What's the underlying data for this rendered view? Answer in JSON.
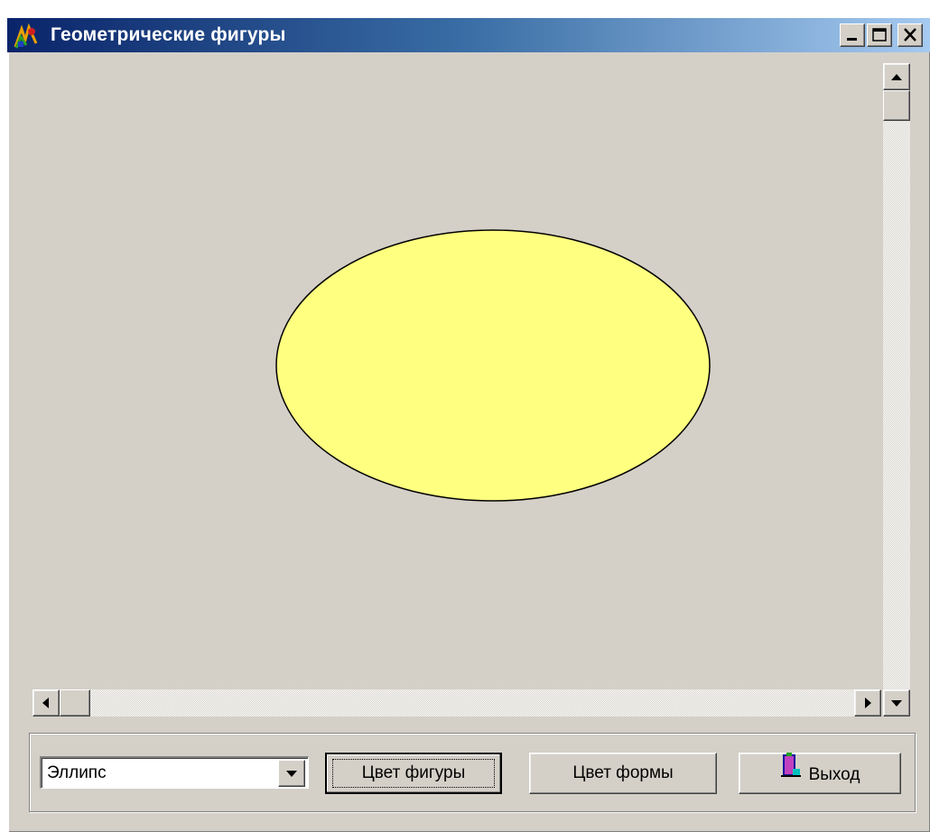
{
  "window": {
    "title": "Геометрические фигуры",
    "background_color": "#d4d0c8",
    "titlebar_colors": [
      "#0a246a",
      "#a6caf0"
    ],
    "icons": {
      "app": "app-figures-icon",
      "minimize": "minimize-icon",
      "maximize": "maximize-icon",
      "close": "close-icon"
    }
  },
  "canvas": {
    "shape": "ellipse",
    "fill_color": "#ffff80",
    "stroke_color": "#000000"
  },
  "scrollbars": {
    "vertical": {
      "position": 0
    },
    "horizontal": {
      "position": 0
    }
  },
  "controls": {
    "shape_select": {
      "value": "Эллипс",
      "icon": "chevron-down-icon"
    },
    "figure_color_button": {
      "label": "Цвет фигуры"
    },
    "form_color_button": {
      "label": "Цвет формы"
    },
    "exit_button": {
      "label": "Выход",
      "icon": "exit-door-icon"
    }
  }
}
